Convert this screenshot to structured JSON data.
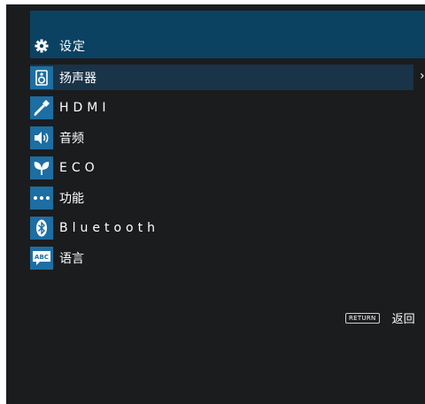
{
  "header": {
    "title": "设定",
    "icon": "gear-icon"
  },
  "menu": {
    "items": [
      {
        "label": "扬声器",
        "icon": "speaker-icon",
        "selected": true
      },
      {
        "label": "HDMI",
        "icon": "hdmi-plug-icon"
      },
      {
        "label": "音频",
        "icon": "volume-icon"
      },
      {
        "label": "ECO",
        "icon": "leaf-icon"
      },
      {
        "label": "功能",
        "icon": "dots-icon"
      },
      {
        "label": "Bluetooth",
        "icon": "bluetooth-icon"
      },
      {
        "label": "语言",
        "icon": "abc-icon"
      }
    ],
    "expand_arrow": "›"
  },
  "footer": {
    "return_key": "RETURN",
    "return_label": "返回"
  },
  "colors": {
    "background": "#1b1c1e",
    "header": "#0b4262",
    "selected_row": "#193348",
    "icon_tile": "#1d6ea3"
  }
}
